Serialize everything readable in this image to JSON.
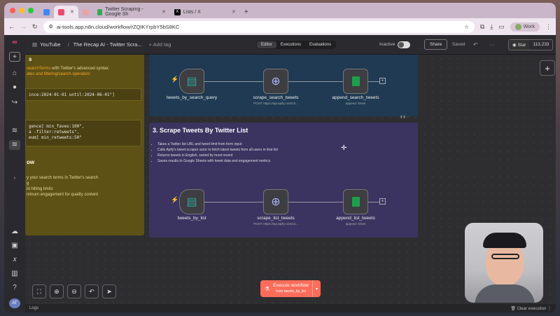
{
  "browser": {
    "tabs": [
      {
        "label": "",
        "color": "#4285f4"
      },
      {
        "label": "",
        "color": "#ea4b71"
      },
      {
        "label": "",
        "color": "#e8a3a9"
      },
      {
        "label": "Twitter Scraping - Google Sh",
        "color": "#34a853"
      },
      {
        "label": "Lists / X",
        "color": "#000000"
      }
    ],
    "url": "ai-tools.app.n8n.cloud/workflow/rZQIKYrpbY5bS8KC",
    "profile": "Work"
  },
  "topbar": {
    "breadcrumb_project": "YouTube",
    "workflow_title": "The Recap AI - Twitter Scra...",
    "add_tag": "+ Add tag",
    "tabs": [
      "Editor",
      "Executions",
      "Evaluations"
    ],
    "status": "Inactive",
    "share": "Share",
    "saved": "Saved",
    "more": "···",
    "star": "Star",
    "star_count": "113,233"
  },
  "left_sticky": {
    "heading": "s",
    "line1": "searchTerms",
    "line1_rest": " with Twitter's advanced syntax:",
    "line2": "ates and filtering/search operators",
    "code1": "ince:2024-01-01 until:2024-06-01\"]",
    "code2a": "gence] min_faves:100\",",
    "code2b": "a -filter:retweets\",",
    "code2c": "eum] min_retweets:50\"",
    "heading2": "ow",
    "bullets": [
      "y your search terms in Twitter's search",
      "g",
      "id hitting limits",
      "nimum engagement for quality content"
    ]
  },
  "section2": {
    "nodes": [
      {
        "label": "tweets_by_search_query",
        "sub": ""
      },
      {
        "label": "scrape_search_tweets",
        "sub": "POST: https://api.apify.com/v2..."
      },
      {
        "label": "append_search_tweets",
        "sub": "append: sheet"
      }
    ]
  },
  "section3": {
    "title": "3. Scrape Tweets By Twitter List",
    "bullets": [
      "Takes a Twitter list URL and tweet limit from form input",
      "Calls Apify's tweet-scraper actor to fetch latest tweets from all users in that list",
      "Returns tweets in English, sorted by most recent",
      "Saves results to Google Sheets with tweet data and engagement metrics"
    ],
    "nodes": [
      {
        "label": "tweets_by_list",
        "sub": ""
      },
      {
        "label": "scrape_list_tweets",
        "sub": "POST: https://api.apify.com/v2..."
      },
      {
        "label": "append_list_tweets",
        "sub": "append: sheet"
      }
    ]
  },
  "execute": {
    "label": "Execute workflow",
    "sub": "from tweets_by_list"
  },
  "logs": {
    "label": "Logs",
    "clear": "Clear execution"
  },
  "sidebar_avatar": "AT"
}
